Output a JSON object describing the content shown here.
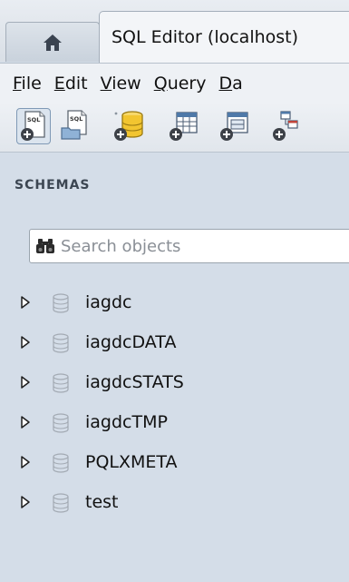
{
  "tabs": {
    "home": {
      "icon": "home-icon"
    },
    "active": {
      "label": "SQL Editor (localhost)"
    }
  },
  "menu": [
    {
      "mnemonic": "F",
      "rest": "ile"
    },
    {
      "mnemonic": "E",
      "rest": "dit"
    },
    {
      "mnemonic": "V",
      "rest": "iew"
    },
    {
      "mnemonic": "Q",
      "rest": "uery"
    },
    {
      "mnemonic": "D",
      "rest": "a"
    }
  ],
  "toolbar": {
    "icons": [
      "new-sql-tab-icon",
      "open-sql-file-icon",
      "new-schema-icon",
      "new-table-icon",
      "new-view-icon",
      "new-routine-icon"
    ]
  },
  "schemas": {
    "header": "SCHEMAS",
    "search": {
      "placeholder": "Search objects",
      "value": ""
    },
    "items": [
      {
        "name": "iagdc"
      },
      {
        "name": "iagdcDATA"
      },
      {
        "name": "iagdcSTATS"
      },
      {
        "name": "iagdcTMP"
      },
      {
        "name": "PQLXMETA"
      },
      {
        "name": "test"
      }
    ]
  },
  "colors": {
    "panel_bg": "#d4dde8",
    "menubar_bg": "#eef1f5",
    "db_icon_outline": "#a3aab3",
    "folder_yellow": "#f2c530"
  }
}
